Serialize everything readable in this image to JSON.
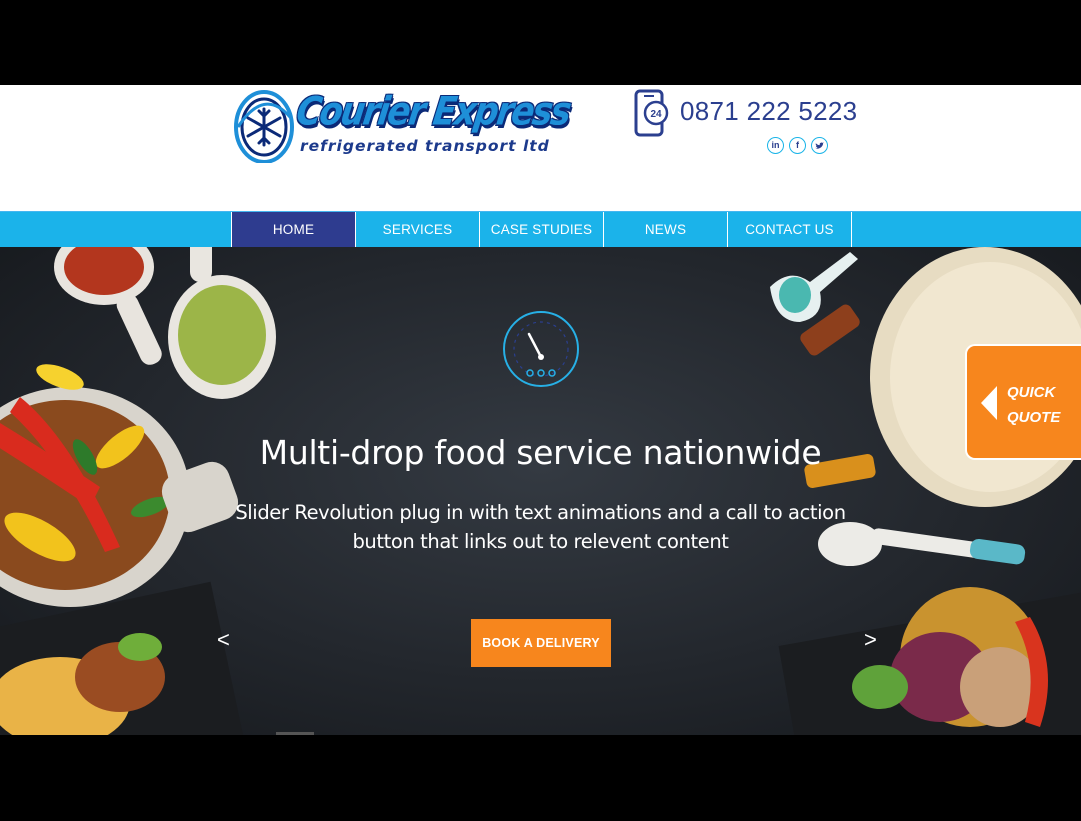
{
  "header": {
    "logo": {
      "title": "Courier Express",
      "subtitle": "refrigerated transport ltd",
      "emblem_icon": "snowflake-icon"
    },
    "phone": {
      "icon": "phone-24-icon",
      "number": "0871 222 5223"
    },
    "socials": [
      {
        "name": "linkedin",
        "glyph": "in"
      },
      {
        "name": "facebook",
        "glyph": "f"
      },
      {
        "name": "twitter",
        "glyph": "t"
      }
    ]
  },
  "nav": {
    "items": [
      {
        "label": "HOME",
        "active": true
      },
      {
        "label": "SERVICES",
        "active": false
      },
      {
        "label": "CASE STUDIES",
        "active": false
      },
      {
        "label": "NEWS",
        "active": false
      },
      {
        "label": "CONTACT US",
        "active": false
      }
    ]
  },
  "hero": {
    "icon": "speedometer-icon",
    "title": "Multi-drop food service nationwide",
    "text": "Slider Revolution plug in with text animations and a call to action button that links out to relevent content",
    "cta_label": "BOOK A DELIVERY",
    "prev_arrow": "<",
    "next_arrow": ">"
  },
  "quick_quote": {
    "line1": "QUICK",
    "line2": "QUOTE"
  },
  "colors": {
    "nav_bg": "#1bb3ea",
    "nav_active": "#2e3c8f",
    "accent_orange": "#f7861d",
    "phone_text": "#2b3f8f",
    "hero_bg": "#262a30"
  }
}
